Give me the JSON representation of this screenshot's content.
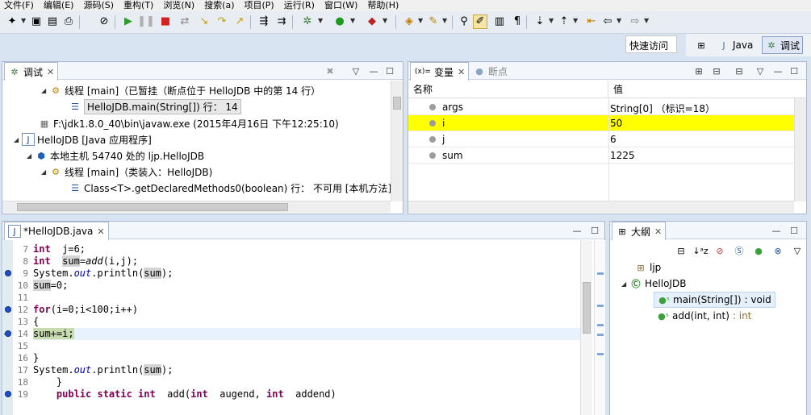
{
  "menu": [
    "文件(F)",
    "编辑(E)",
    "源码(S)",
    "重构(T)",
    "浏览(N)",
    "搜索(a)",
    "项目(P)",
    "运行(R)",
    "窗口(W)",
    "帮助(H)"
  ],
  "quick_access": "快速访问",
  "perspectives": {
    "java": "Java",
    "debug": "调试"
  },
  "debug_view": {
    "tab": "调试",
    "rows": [
      "线程 [main]（已暂挂（断点位于 HelloJDB 中的第 14 行）",
      "HelloJDB.main(String[]) 行： 14",
      "F:\\jdk1.8.0_40\\bin\\javaw.exe (2015年4月16日 下午12:25:10)",
      "HelloJDB [Java 应用程序]",
      "本地主机 54740 处的 ljp.HelloJDB",
      "线程 [main]（类装入：HelloJDB)",
      "Class<T>.getDeclaredMethods0(boolean) 行： 不可用 [本机方法]"
    ]
  },
  "variables_view": {
    "tab": "变量",
    "tab2": "断点",
    "col_name": "名称",
    "col_value": "值",
    "rows": [
      {
        "name": "args",
        "value": "String[0]  （标识=18）"
      },
      {
        "name": "i",
        "value": "50"
      },
      {
        "name": "j",
        "value": "6"
      },
      {
        "name": "sum",
        "value": "1225"
      }
    ],
    "highlight_color": "#ffff00"
  },
  "editor": {
    "tab": "*HelloJDB.java",
    "lines": [
      {
        "n": "7",
        "seg": [
          [
            "kw",
            "int"
          ],
          [
            "",
            "  j=6;"
          ]
        ]
      },
      {
        "n": "8",
        "seg": [
          [
            "kw",
            "int"
          ],
          [
            "",
            "  "
          ],
          [
            "occ",
            "sum"
          ],
          [
            "",
            "="
          ],
          [
            "it",
            "add"
          ],
          [
            "",
            "(i,j);"
          ]
        ]
      },
      {
        "n": "9",
        "seg": [
          [
            "",
            "System."
          ],
          [
            "fld",
            "out"
          ],
          [
            "",
            ".println("
          ],
          [
            "occ",
            "sum"
          ],
          [
            "",
            ");"
          ]
        ]
      },
      {
        "n": "10",
        "seg": [
          [
            "occ",
            "sum"
          ],
          [
            "",
            "=0;"
          ]
        ]
      },
      {
        "n": "11",
        "seg": [
          [
            "",
            ""
          ]
        ]
      },
      {
        "n": "12",
        "seg": [
          [
            "kw",
            "for"
          ],
          [
            "",
            "(i=0;i<100;i++)"
          ]
        ]
      },
      {
        "n": "13",
        "seg": [
          [
            "",
            "{"
          ]
        ]
      },
      {
        "n": "14",
        "seg": [
          [
            "cur",
            "sum+=i;"
          ]
        ]
      },
      {
        "n": "15",
        "seg": [
          [
            "",
            ""
          ]
        ]
      },
      {
        "n": "16",
        "seg": [
          [
            "",
            "}"
          ]
        ]
      },
      {
        "n": "17",
        "seg": [
          [
            "",
            "System."
          ],
          [
            "fld",
            "out"
          ],
          [
            "",
            ".println("
          ],
          [
            "occ",
            "sum"
          ],
          [
            "",
            ");"
          ]
        ]
      },
      {
        "n": "18",
        "seg": [
          [
            "",
            "    }"
          ]
        ]
      },
      {
        "n": "19",
        "seg": [
          [
            "",
            "    "
          ],
          [
            "kw",
            "public static int"
          ],
          [
            "",
            "  add("
          ],
          [
            "kw",
            "int"
          ],
          [
            "",
            "  augend, "
          ],
          [
            "kw",
            "int"
          ],
          [
            "",
            "  addend)"
          ]
        ]
      }
    ],
    "current_line_color": "#c6dbae"
  },
  "outline_view": {
    "tab": "大纲",
    "package": "ljp",
    "class": "HelloJDB",
    "methods": [
      {
        "name": "main(String[])",
        "ret": ": void"
      },
      {
        "name": "add(int, int)",
        "ret": ": int"
      }
    ]
  }
}
